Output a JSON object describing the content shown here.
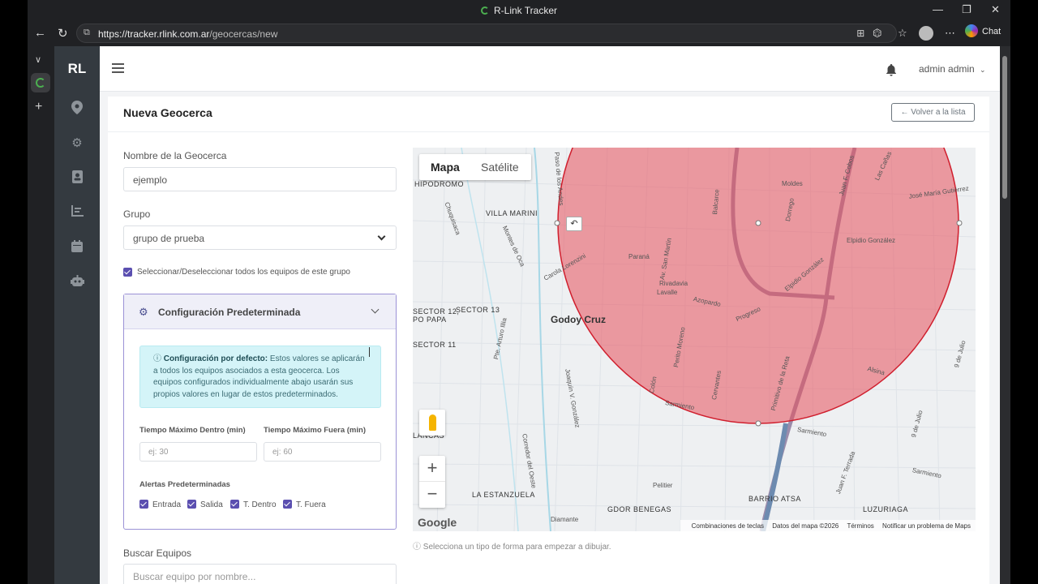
{
  "browser": {
    "window_title": "R-Link Tracker",
    "url_host": "https://tracker.rlink.com.ar",
    "url_path": "/geocercas/new",
    "chat_label": "Chat"
  },
  "app": {
    "brand": "RL",
    "user_name": "admin admin",
    "sidebar_icons": [
      "map-pin-icon",
      "gears-icon",
      "address-book-icon",
      "report-icon",
      "calendar-icon",
      "robot-icon"
    ]
  },
  "page": {
    "title": "Nueva Geocerca",
    "back_button": "← Volver a la lista"
  },
  "form": {
    "name_label": "Nombre de la Geocerca",
    "name_value": "ejemplo",
    "group_label": "Grupo",
    "group_value": "grupo de prueba",
    "select_all_label": "Seleccionar/Deseleccionar todos los equipos de este grupo",
    "search_label": "Buscar Equipos",
    "search_placeholder": "Buscar equipo por nombre..."
  },
  "config": {
    "title": "Configuración Predeterminada",
    "info_bold": "Configuración por defecto:",
    "info_text": " Estos valores se aplicarán a todos los equipos asociados a esta geocerca. Los equipos configurados individualmente abajo usarán sus propios valores en lugar de estos predeterminados.",
    "max_in_label": "Tiempo Máximo Dentro (min)",
    "max_in_placeholder": "ej: 30",
    "max_out_label": "Tiempo Máximo Fuera (min)",
    "max_out_placeholder": "ej: 60",
    "alerts_label": "Alertas Predeterminadas",
    "alerts": [
      "Entrada",
      "Salida",
      "T. Dentro",
      "T. Fuera"
    ]
  },
  "map": {
    "type_map": "Mapa",
    "type_satellite": "Satélite",
    "google": "Google",
    "footer": [
      "Combinaciones de teclas",
      "Datos del mapa ©2026",
      "Términos",
      "Notificar un problema de Maps"
    ],
    "zoom_in": "+",
    "zoom_out": "−",
    "circle_color": "#e8505b",
    "areas": [
      "HIPODROMO",
      "VILLA MARINI",
      "SECTOR 12,",
      "PO PAPA",
      "SECTOR 13",
      "SECTOR 11",
      "Godoy Cruz",
      "LA ESTANZUELA",
      "GDOR BENEGAS",
      "BARRIO ATSA",
      "LUZURIAGA",
      "LANCAS"
    ],
    "streets": [
      "Moldes",
      "Balcarce",
      "Av. San Martín",
      "Paraná",
      "Rivadavia",
      "Lavalle",
      "Azopardo",
      "Progreso",
      "Elpidio González",
      "Elpidio González",
      "José María Gutiérrez",
      "Las Cañas",
      "Juan F. Cobos",
      "Dorrego",
      "Sarmiento",
      "Sarmiento",
      "Sarmiento",
      "Alsina",
      "9 de Julio",
      "9 de Julio",
      "Colón",
      "Perito Moreno",
      "Cervantes",
      "Primitivo de la Reta",
      "Pte. Arturo Illia",
      "Joaquín V. González",
      "Corredor del Oeste",
      "Chuquisaca",
      "Montes de Oca",
      "Carola Lorenzini",
      "Paso de los Andes",
      "Diamante",
      "Pelitier",
      "Juan F. Terrada"
    ],
    "hint": "ⓘ Selecciona un tipo de forma para empezar a dibujar."
  }
}
